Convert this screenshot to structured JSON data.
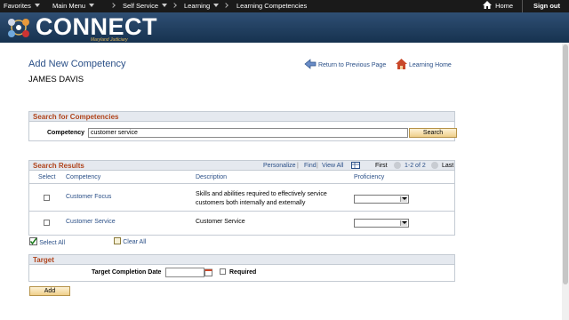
{
  "topnav": {
    "favorites": "Favorites",
    "main_menu": "Main Menu",
    "self_service": "Self Service",
    "learning": "Learning",
    "learning_competencies": "Learning Competencies",
    "home": "Home",
    "sign_out": "Sign out"
  },
  "banner": {
    "logo": "CONNECT",
    "subtitle": "Maryland Judiciary"
  },
  "page": {
    "title": "Add New Competency",
    "person": "JAMES DAVIS",
    "return_link": "Return to Previous Page",
    "learning_home": "Learning Home"
  },
  "search": {
    "header": "Search for Competencies",
    "label": "Competency",
    "value": "customer service",
    "button": "Search"
  },
  "results": {
    "header": "Search Results",
    "personalize": "Personalize",
    "find": "Find",
    "view_all": "View All",
    "first": "First",
    "range": "1-2 of 2",
    "last": "Last",
    "columns": [
      "Select",
      "Competency",
      "Description",
      "Proficiency"
    ],
    "rows": [
      {
        "competency": "Customer Focus",
        "description": "Skills and abilities required to effectively service customers both internally and externally",
        "proficiency": ""
      },
      {
        "competency": "Customer Service",
        "description": "Customer Service",
        "proficiency": ""
      }
    ],
    "select_all": "Select All",
    "clear_all": "Clear All"
  },
  "target": {
    "header": "Target",
    "date_label": "Target Completion Date",
    "date_value": "",
    "required": "Required"
  },
  "add_button": "Add",
  "colors": {
    "nav_bg": "#1a1a1a",
    "banner": "#16324f",
    "link": "#2a4f87",
    "section_header": "#b0441c"
  }
}
